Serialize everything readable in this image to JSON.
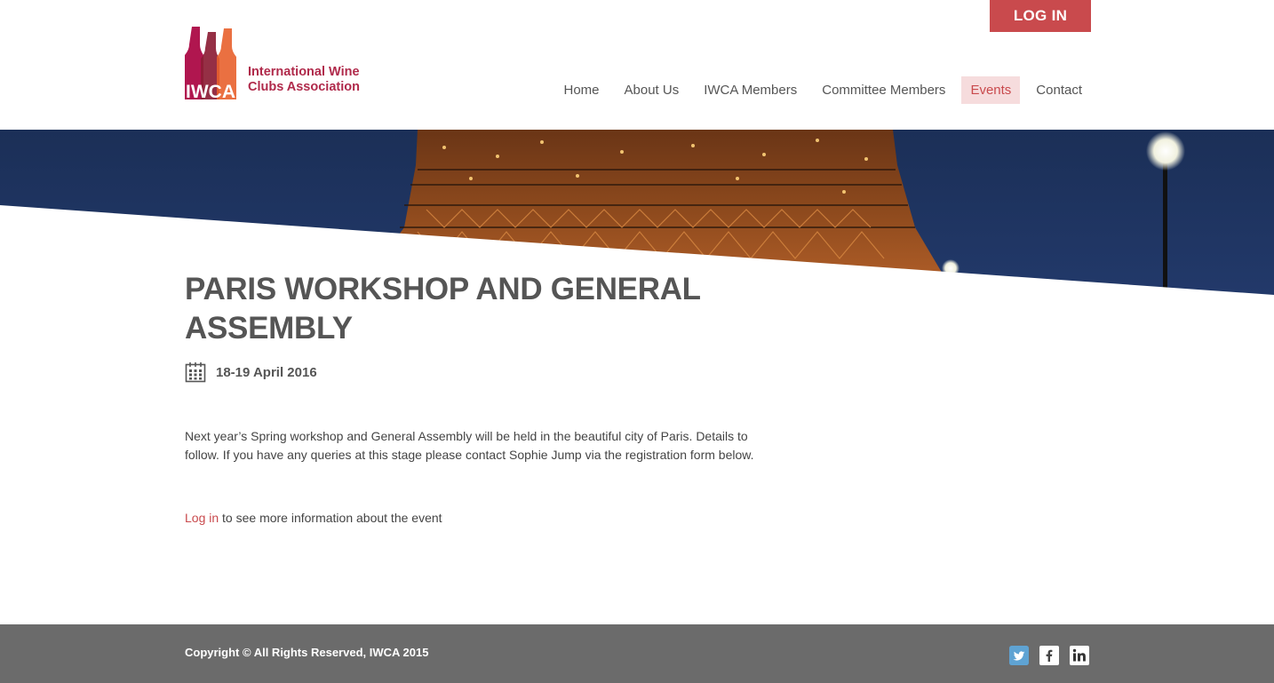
{
  "header": {
    "login_label": "LOG IN",
    "logo": {
      "acronym": "IWCA",
      "line1": "International Wine",
      "line2": "Clubs Association",
      "colors": [
        "#b0164f",
        "#8c1d35",
        "#e8612c",
        "#c81f4e"
      ]
    },
    "nav": [
      {
        "label": "Home",
        "active": false
      },
      {
        "label": "About Us",
        "active": false
      },
      {
        "label": "IWCA Members",
        "active": false
      },
      {
        "label": "Committee Members",
        "active": false
      },
      {
        "label": "Events",
        "active": true
      },
      {
        "label": "Contact",
        "active": false
      }
    ],
    "accent": "#c94a4d"
  },
  "event": {
    "title": "PARIS WORKSHOP AND GENERAL ASSEMBLY",
    "date": "18-19 April 2016",
    "date_icon": "calendar-icon",
    "description": "Next year’s Spring workshop and General Assembly will be held in the beautiful city of Paris. Details to follow. If you have any queries at this stage please contact Sophie Jump via the registration form below.",
    "login_link": "Log in",
    "login_note": " to see more information about the event"
  },
  "footer": {
    "copyright": "Copyright © All Rights Reserved, IWCA 2015",
    "social": [
      "twitter-icon",
      "facebook-icon",
      "linkedin-icon"
    ]
  }
}
